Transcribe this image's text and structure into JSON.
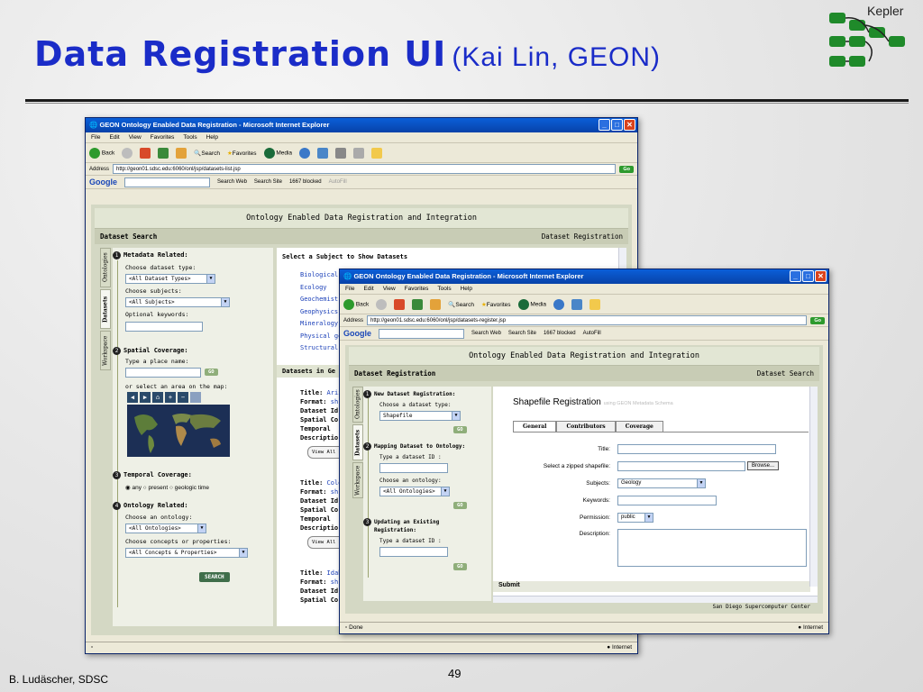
{
  "slide": {
    "title_main": "Data Registration UI",
    "title_sub": "(Kai Lin, GEON)",
    "logo_text": "Kepler",
    "footer_left": "B. Ludäscher, SDSC",
    "page_number": "49"
  },
  "colors": {
    "title_blue": "#1a2cc8",
    "xp_titlebar": "#0a5fd8",
    "app_bg": "#d4d8c4",
    "search_btn": "#3f6e4a"
  },
  "win1": {
    "title": "GEON Ontology Enabled Data Registration - Microsoft Internet Explorer",
    "menu": [
      "File",
      "Edit",
      "View",
      "Favorites",
      "Tools",
      "Help"
    ],
    "toolbar": {
      "back": "Back",
      "search": "Search",
      "favorites": "Favorites",
      "media": "Media"
    },
    "address_label": "Address",
    "address": "http://geon01.sdsc.edu:6060/onl/jsp/datasets-list.jsp",
    "go": "Go",
    "google": {
      "logo": "Google",
      "search_web": "Search Web",
      "search_site": "Search Site",
      "blocked": "1667 blocked",
      "autofill": "AutoFill"
    },
    "status_right": "Internet",
    "app_header": "Ontology Enabled Data Registration and Integration",
    "section_left": "Dataset Search",
    "section_right": "Dataset Registration",
    "vtabs": [
      "Ontologies",
      "Datasets",
      "Workspace"
    ],
    "left": {
      "s1_title": "Metadata Related:",
      "choose_type": "Choose dataset type:",
      "type_value": "<All Dataset Types>",
      "choose_subjects": "Choose subjects:",
      "subjects_value": "<All Subjects>",
      "optional_keywords": "Optional keywords:",
      "s2_title": "Spatial Coverage:",
      "place_name": "Type a place name:",
      "go": "GO",
      "map_label": "or select an area on the map:",
      "s3_title": "Temporal Coverage:",
      "radio_any": "any",
      "radio_present": "present",
      "radio_geo": "geologic time",
      "s4_title": "Ontology Related:",
      "choose_ontology": "Choose an ontology:",
      "ontology_value": "<All Ontologies>",
      "choose_concepts": "Choose concepts or properties:",
      "concepts_value": "<All Concepts & Properties>",
      "search": "SEARCH"
    },
    "right": {
      "subject_header": "Select a Subject to Show Datasets",
      "subjects": [
        "Biological o",
        "Ecology",
        "Geochemist",
        "Geophysics",
        "Mineralogy",
        "Physical ge",
        "Structural g"
      ],
      "datasets_header": "Datasets in Ge",
      "field_labels": [
        "Title:",
        "Format:",
        "Dataset Id",
        "Spatial Co",
        "Temporal",
        "Descriptio"
      ],
      "items": [
        {
          "title": "Arizo",
          "format": "sh"
        },
        {
          "title": "Colo",
          "format": "sh"
        },
        {
          "title": "Idah",
          "format": "sh"
        }
      ],
      "view_all": "View All M"
    }
  },
  "win2": {
    "title": "GEON Ontology Enabled Data Registration - Microsoft Internet Explorer",
    "menu": [
      "File",
      "Edit",
      "View",
      "Favorites",
      "Tools",
      "Help"
    ],
    "address_label": "Address",
    "address": "http://geon01.sdsc.edu:6060/onl/jsp/datasets-register.jsp",
    "go": "Go",
    "status_left": "Done",
    "status_right": "Internet",
    "app_header": "Ontology Enabled Data Registration and Integration",
    "section_left": "Dataset Registration",
    "section_right": "Dataset Search",
    "footer_org": "San Diego Supercomputer Center",
    "left": {
      "s1_title": "New Dataset Registration:",
      "choose_type": "Choose a dataset type:",
      "type_value": "Shapefile",
      "go": "GO",
      "s2_title": "Mapping Dataset to Ontology:",
      "type_id": "Type a dataset ID :",
      "choose_ontology": "Choose an ontology:",
      "ontology_value": "<All Ontologies>",
      "s3_title_1": "Updating an Existing",
      "s3_title_2": "Registration:",
      "type_id_2": "Type a dataset ID :"
    },
    "form": {
      "heading": "Shapefile Registration",
      "heading_note": "using GEON Metadata Schema",
      "tabs": [
        "General",
        "Contributors",
        "Coverage"
      ],
      "title_label": "Title:",
      "shapefile_label": "Select a zipped shapefile:",
      "browse": "Browse...",
      "subjects_label": "Subjects:",
      "subjects_value": "Geology",
      "keywords_label": "Keywords:",
      "permission_label": "Permission:",
      "permission_value": "public",
      "description_label": "Description:",
      "submit": "Submit"
    }
  }
}
